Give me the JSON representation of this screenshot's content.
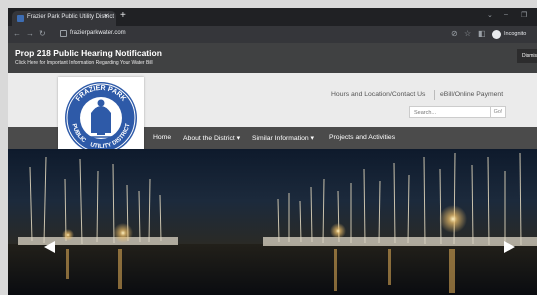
{
  "browser": {
    "tab_title": "Frazier Park Public Utility District",
    "tab_close": "×",
    "new_tab": "+",
    "url": "frazierparkwater.com",
    "incognito_label": "Incognito",
    "window_controls": [
      "⌄",
      "–",
      "❐"
    ]
  },
  "notice": {
    "title": "Prop 218 Public Hearing Notification",
    "subtitle": "Click Here for Important Information Regarding Your Water Bill",
    "dismiss_label": "Dismiss"
  },
  "logo": {
    "top_text": "FRAZIER PARK",
    "left_text": "PUBLIC",
    "right_text": "UTILITY DISTRICT"
  },
  "header": {
    "link_hours": "Hours and Location/Contact Us",
    "link_ebill": "eBill/Online Payment",
    "search_placeholder": "Search...",
    "go_label": "Go!"
  },
  "nav": {
    "items": [
      "Home",
      "About the District ▾",
      "Similar Information ▾",
      "Projects and Activities"
    ]
  },
  "colors": {
    "notice_bar": "#404142",
    "nav_bar": "#4b4b4b",
    "header_bg": "#ebebeb",
    "logo_blue": "#2e5aa8"
  }
}
